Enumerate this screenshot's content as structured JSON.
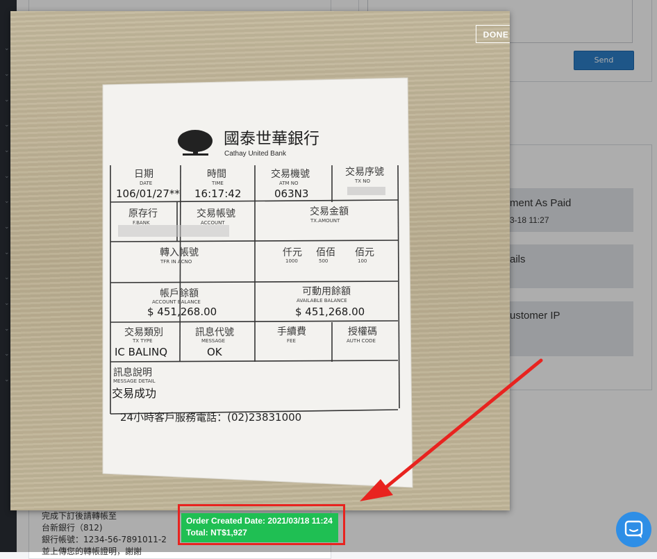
{
  "background_page": {
    "send_label": "Send",
    "status_cards": [
      {
        "title": "ment As Paid",
        "subtitle": "3-18 11:27"
      },
      {
        "title": "ails",
        "subtitle": ""
      },
      {
        "title": "ustomer IP",
        "subtitle": ""
      }
    ],
    "bank_instructions": [
      "完成下訂後請轉帳至",
      "台新銀行（812)",
      "銀行帳號：1234-56-7891011-2",
      "並上傳您的轉帳證明，謝謝"
    ]
  },
  "viewer": {
    "done_label": "DONE",
    "receipt": {
      "bank_name_zh": "國泰世華銀行",
      "bank_name_en": "Cathay United Bank",
      "date_label": "日期",
      "date_label_en": "DATE",
      "date_value": "106/01/27**",
      "time_label": "時間",
      "time_label_en": "TIME",
      "time_value": "16:17:42",
      "atm_label": "交易機號",
      "atm_label_en": "ATM NO",
      "atm_value": "063N3",
      "seq_label": "交易序號",
      "seq_label_en": "TX NO",
      "bank_label": "原存行",
      "bank_label_en": "F.BANK",
      "account_label": "交易帳號",
      "account_label_en": "ACCOUNT",
      "amount_label": "交易金額",
      "amount_label_en": "TX.AMOUNT",
      "transfer_label": "轉入帳號",
      "transfer_label_en": "TFR IN ACNO",
      "thousand_label": "仟元",
      "thousand_label_en": "1000",
      "hundred_label": "佰佰",
      "hundred_label_en": "500",
      "hundred100_label": "佰元",
      "hundred100_label_en": "100",
      "balance_label": "帳戶餘額",
      "balance_label_en": "ACCOUNT BALANCE",
      "balance_value": "$ 451,268.00",
      "available_label": "可動用餘額",
      "available_label_en": "AVAILABLE BALANCE",
      "available_value": "$ 451,268.00",
      "txtype_label": "交易類別",
      "txtype_label_en": "TX TYPE",
      "txtype_value": "IC BALINQ",
      "msg_label": "訊息代號",
      "msg_label_en": "MESSAGE",
      "msg_value": "OK",
      "fee_label": "手續費",
      "fee_label_en": "FEE",
      "auth_label": "授權碼",
      "auth_label_en": "AUTH CODE",
      "detail_label": "訊息說明",
      "detail_label_en": "MESSAGE DETAIL",
      "detail_value": "交易成功",
      "hotline": "24小時客戶服務電話：(02)23831000"
    }
  },
  "order_badge": {
    "created_line": "Order Created Date: 2021/03/18 11:24",
    "total_line": "Total: NT$1,927"
  },
  "colors": {
    "badge_green": "#1fbf53",
    "callout_red": "#e8231f",
    "send_blue": "#2d7fc9",
    "chat_blue": "#2e8ee6"
  },
  "icons": {
    "chat": "chat-bubble-icon",
    "logo": "cathay-tree-logo"
  }
}
